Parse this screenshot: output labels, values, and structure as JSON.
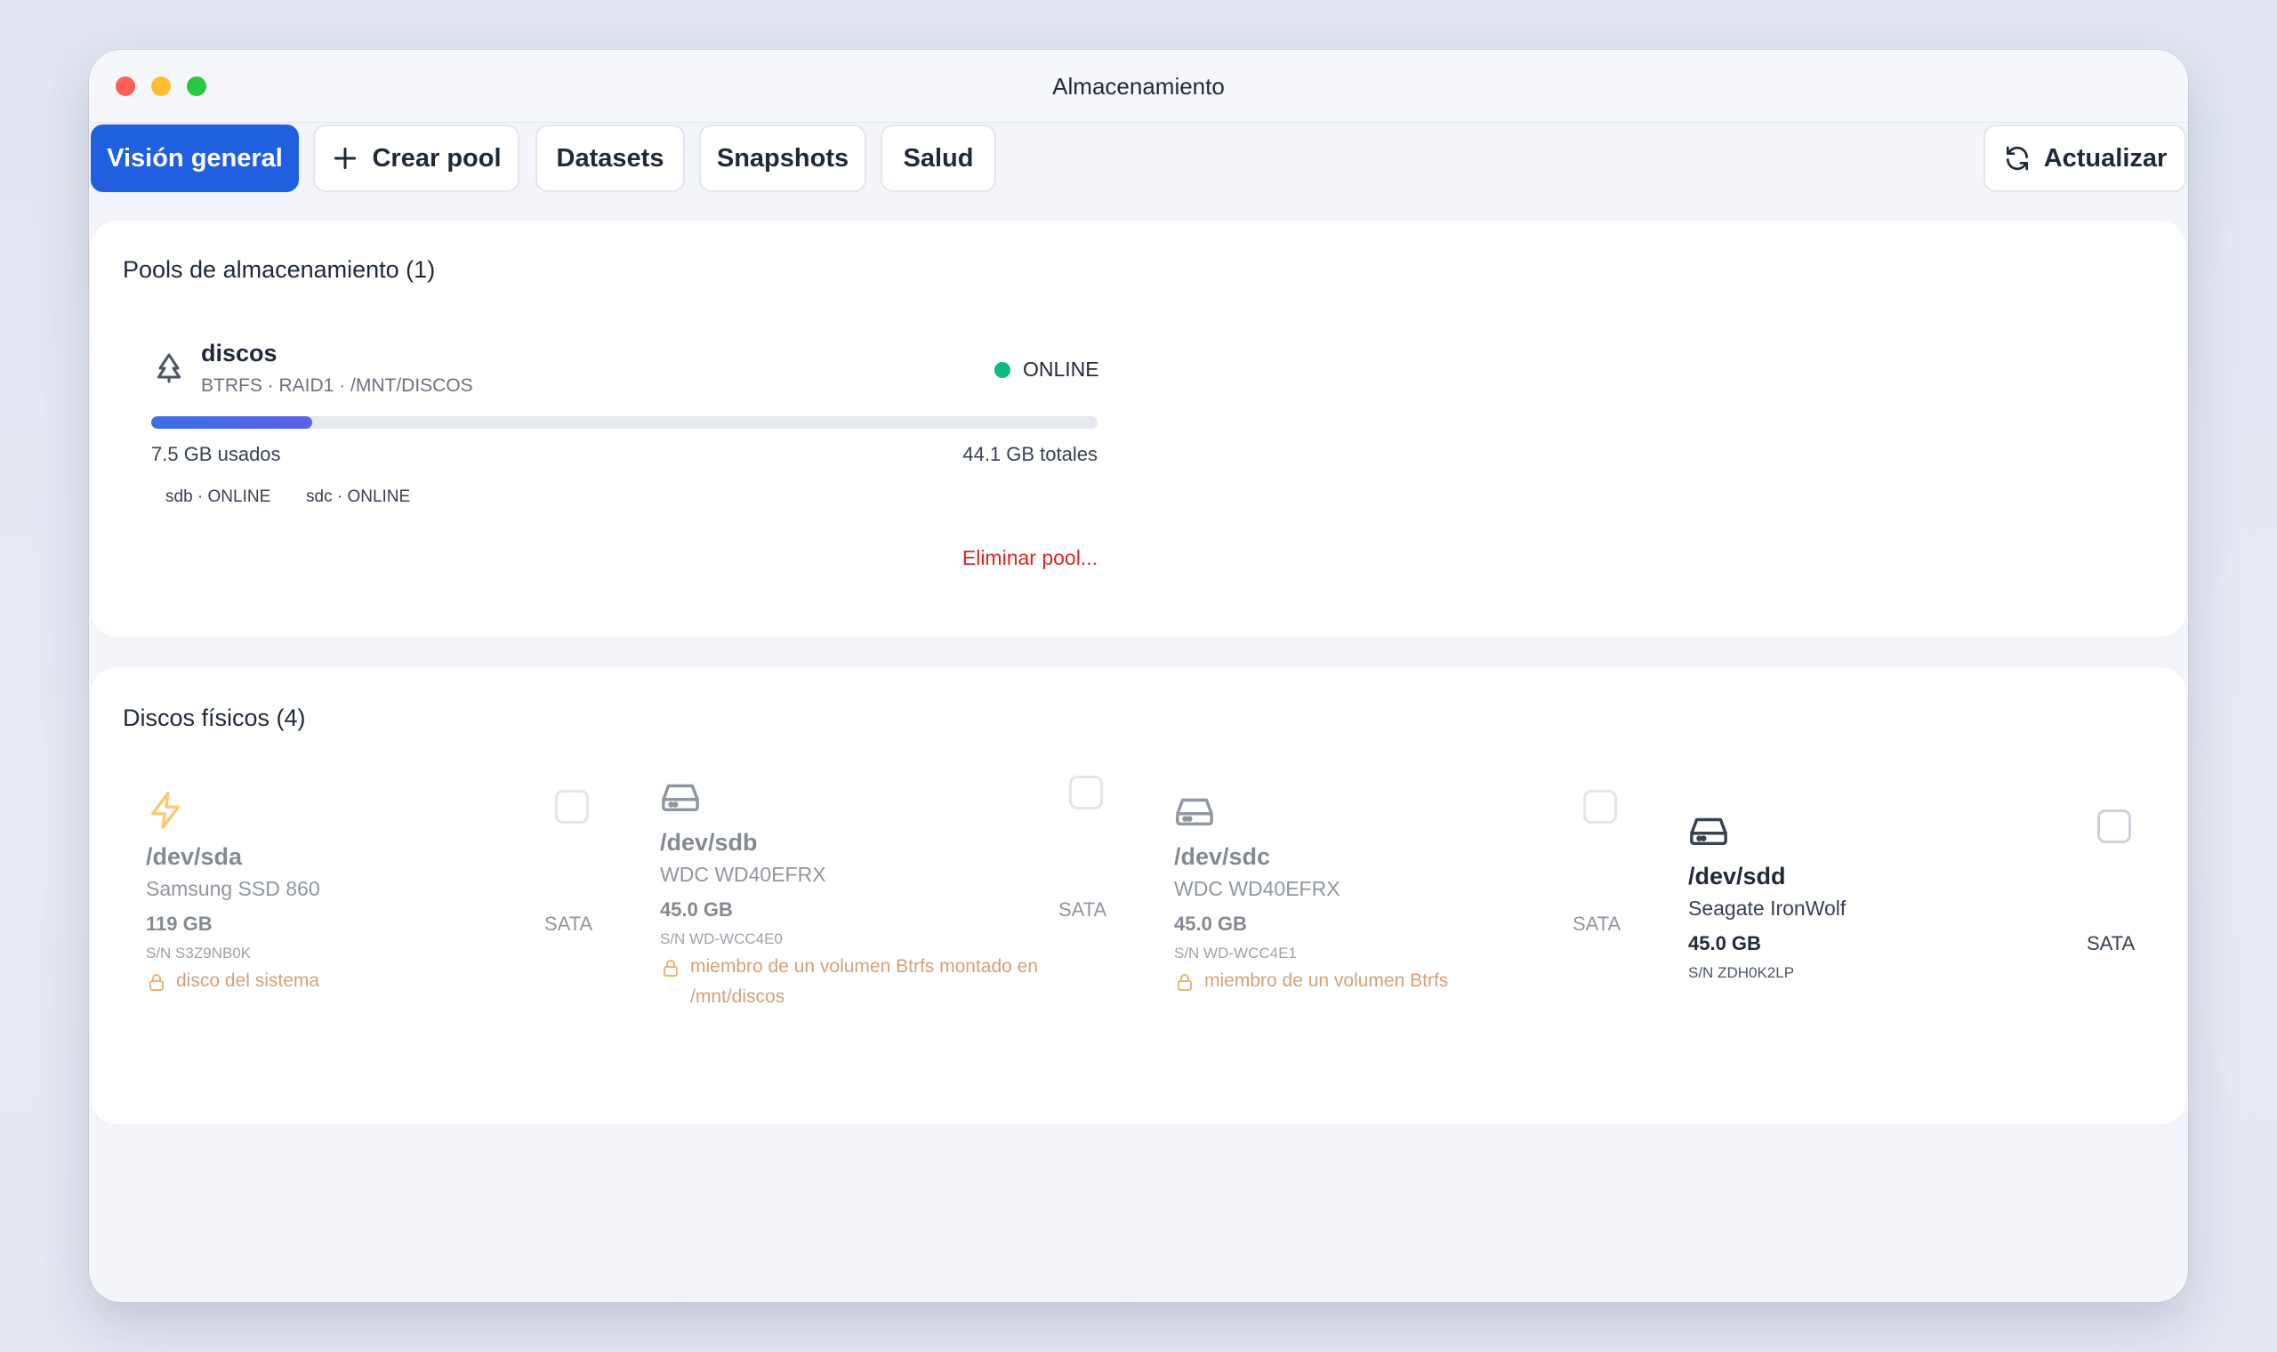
{
  "window": {
    "title": "Almacenamiento"
  },
  "toolbar": {
    "tabs": [
      {
        "label": "Visión general",
        "active": true
      },
      {
        "label": "Crear pool",
        "icon": "plus-icon"
      },
      {
        "label": "Datasets"
      },
      {
        "label": "Snapshots"
      },
      {
        "label": "Salud"
      }
    ],
    "refresh_label": "Actualizar"
  },
  "pools": {
    "title": "Pools de almacenamiento (1)",
    "items": [
      {
        "name": "discos",
        "meta": "BTRFS · RAID1 · /MNT/DISCOS",
        "status": "ONLINE",
        "status_color": "#10b981",
        "used_fraction": 0.17,
        "used_label": "7.5 GB usados",
        "total_label": "44.1 GB totales",
        "members": [
          "sdb · ONLINE",
          "sdc · ONLINE"
        ],
        "delete_label": "Eliminar pool..."
      }
    ]
  },
  "disks": {
    "title": "Discos físicos (4)",
    "items": [
      {
        "dev": "/dev/sda",
        "model": "Samsung SSD 860",
        "size": "119 GB",
        "bus": "SATA",
        "sn": "S/N S3Z9NB0K",
        "lock": "disco del sistema",
        "icon": "bolt-icon"
      },
      {
        "dev": "/dev/sdb",
        "model": "WDC WD40EFRX",
        "size": "45.0 GB",
        "bus": "SATA",
        "sn": "S/N WD-WCC4E0",
        "lock": "miembro de un volumen Btrfs montado en /mnt/discos",
        "icon": "hard-drive-icon"
      },
      {
        "dev": "/dev/sdc",
        "model": "WDC WD40EFRX",
        "size": "45.0 GB",
        "bus": "SATA",
        "sn": "S/N WD-WCC4E1",
        "lock": "miembro de un volumen Btrfs",
        "icon": "hard-drive-icon"
      },
      {
        "dev": "/dev/sdd",
        "model": "Seagate IronWolf",
        "size": "45.0 GB",
        "bus": "SATA",
        "sn": "S/N ZDH0K2LP",
        "lock": "",
        "icon": "hard-drive-icon"
      }
    ]
  },
  "colors": {
    "accent": "#1f5fe0",
    "danger": "#dc2626",
    "warning": "#b45309"
  }
}
